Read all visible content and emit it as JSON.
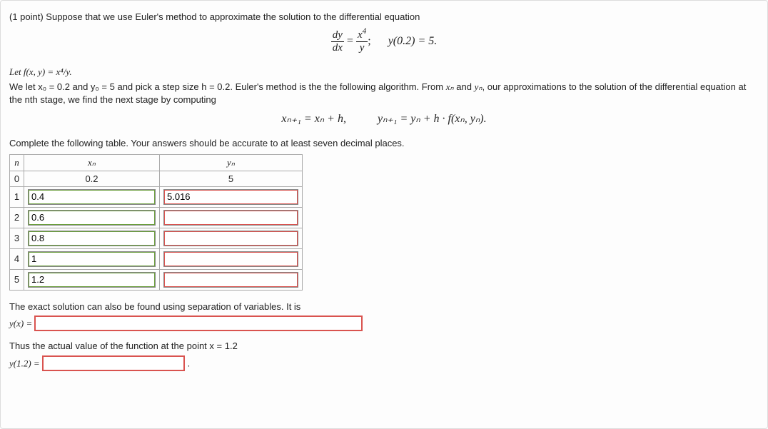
{
  "points_line": "(1 point) Suppose that we use Euler's method to approximate the solution to the differential equation",
  "ode": {
    "dy": "dy",
    "dx": "dx",
    "num": "x",
    "num_pow": "4",
    "den": "y",
    "ic_label": "y(0.2) = 5.",
    "semicolon": ";"
  },
  "setup": {
    "let_f": "Let f(x, y) = x⁴/y.",
    "line2a": "We let x₀ = 0.2 and y₀ = 5 and pick a step size h = 0.2. Euler's method is the the following algorithm. From ",
    "xn": "xₙ",
    "and": " and ",
    "yn": "yₙ",
    "line2b": ", our approximations to the solution of the differential equation at the nth stage, we find the next stage by computing",
    "recur_x": "xₙ₊₁ = xₙ + h,",
    "recur_y": "yₙ₊₁ = yₙ + h · f(xₙ, yₙ)."
  },
  "table_instr": "Complete the following table. Your answers should be accurate to at least seven decimal places.",
  "headers": {
    "n": "n",
    "xn": "xₙ",
    "yn": "yₙ"
  },
  "rows": [
    {
      "n": "0",
      "xn": "0.2",
      "yn": "5",
      "readonly": true
    },
    {
      "n": "1",
      "xn": "0.4",
      "yn": "5.016",
      "xn_good": true,
      "yn_bad": true
    },
    {
      "n": "2",
      "xn": "0.6",
      "yn": "",
      "xn_good": true,
      "yn_bad": true
    },
    {
      "n": "3",
      "xn": "0.8",
      "yn": "",
      "xn_good": true,
      "yn_bad": true
    },
    {
      "n": "4",
      "xn": "1",
      "yn": "",
      "xn_good": true,
      "yn_bad": true
    },
    {
      "n": "5",
      "xn": "1.2",
      "yn": "",
      "xn_good": true,
      "yn_bad": true
    }
  ],
  "exact_line": "The exact solution can also be found using separation of variables. It is",
  "yx_label": "y(x) = ",
  "thus_line": "Thus the actual value of the function at the point x = 1.2",
  "y12_label": "y(1.2) = ",
  "period": "."
}
